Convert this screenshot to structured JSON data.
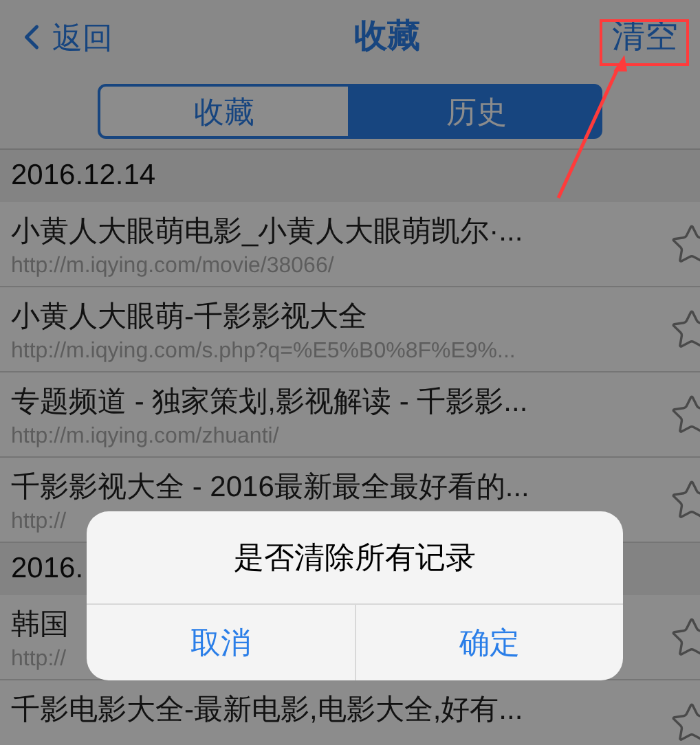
{
  "nav": {
    "back": "返回",
    "title": "收藏",
    "action": "清空"
  },
  "segments": [
    {
      "label": "收藏",
      "selected": false
    },
    {
      "label": "历史",
      "selected": true
    }
  ],
  "sections": [
    {
      "date": "2016.12.14",
      "items": [
        {
          "title": "小黄人大眼萌电影_小黄人大眼萌凯尔·...",
          "url": "http://m.iqying.com/movie/38066/"
        },
        {
          "title": "小黄人大眼萌-千影影视大全",
          "url": "http://m.iqying.com/s.php?q=%E5%B0%8F%E9%..."
        },
        {
          "title": "专题频道 - 独家策划,影视解读 - 千影影...",
          "url": "http://m.iqying.com/zhuanti/"
        },
        {
          "title": "千影影视大全 - 2016最新最全最好看的...",
          "url": "http://"
        }
      ]
    },
    {
      "date": "2016.",
      "items": [
        {
          "title": "韩国",
          "url": "http://"
        },
        {
          "title": "千影电影大全-最新电影,电影大全,好有..."
        }
      ]
    }
  ],
  "dialog": {
    "message": "是否清除所有记录",
    "buttons": [
      "取消",
      "确定"
    ]
  }
}
